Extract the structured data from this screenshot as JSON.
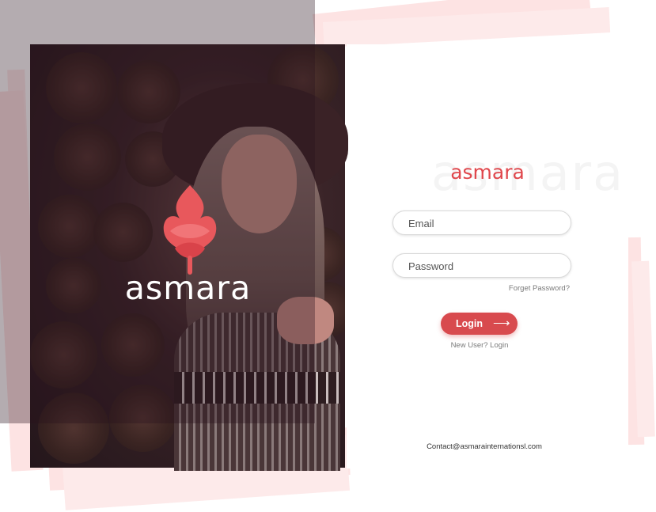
{
  "brand": {
    "name": "asmara",
    "watermark": "asmara",
    "accent_color": "#e0474c",
    "button_color": "#d84a4e"
  },
  "hero": {
    "logo_text": "asmara",
    "logo_icon": "flame-leaf-icon"
  },
  "login_form": {
    "email_placeholder": "Email",
    "password_placeholder": "Password",
    "forgot_password": "Forget Password?",
    "login_label": "Login",
    "login_icon": "arrow-right-icon",
    "new_user": "New User? Login"
  },
  "footer": {
    "contact": "Contact@asmarainternationsl.com"
  }
}
